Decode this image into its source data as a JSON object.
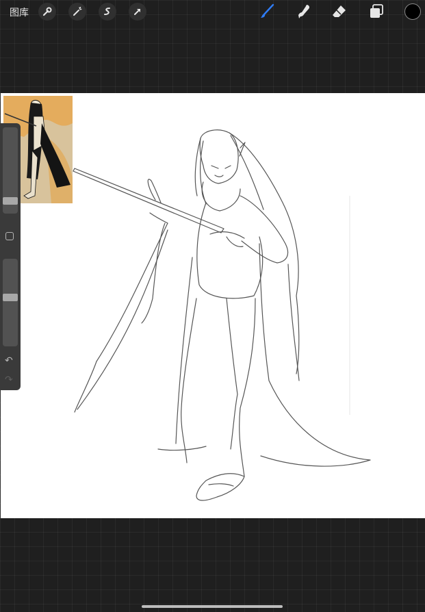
{
  "topbar": {
    "gallery_label": "图库",
    "left_tools": [
      "wrench-icon",
      "magic-wand-icon",
      "selection-icon",
      "transform-arrow-icon"
    ],
    "right_tools": [
      "brush-icon",
      "smudge-icon",
      "eraser-icon",
      "layers-icon"
    ],
    "active_tool": "brush-icon",
    "active_color": "#2f7cf6",
    "current_color": "#000000"
  },
  "sidebar": {
    "brush_size_level": 0.11,
    "opacity_level": 0.56,
    "icons": [
      "modify-square-icon",
      "undo-icon",
      "redo-icon"
    ]
  },
  "colors": {
    "canvas": "#ffffff",
    "background": "#1f1f1f",
    "sketch_stroke": "#555555"
  }
}
